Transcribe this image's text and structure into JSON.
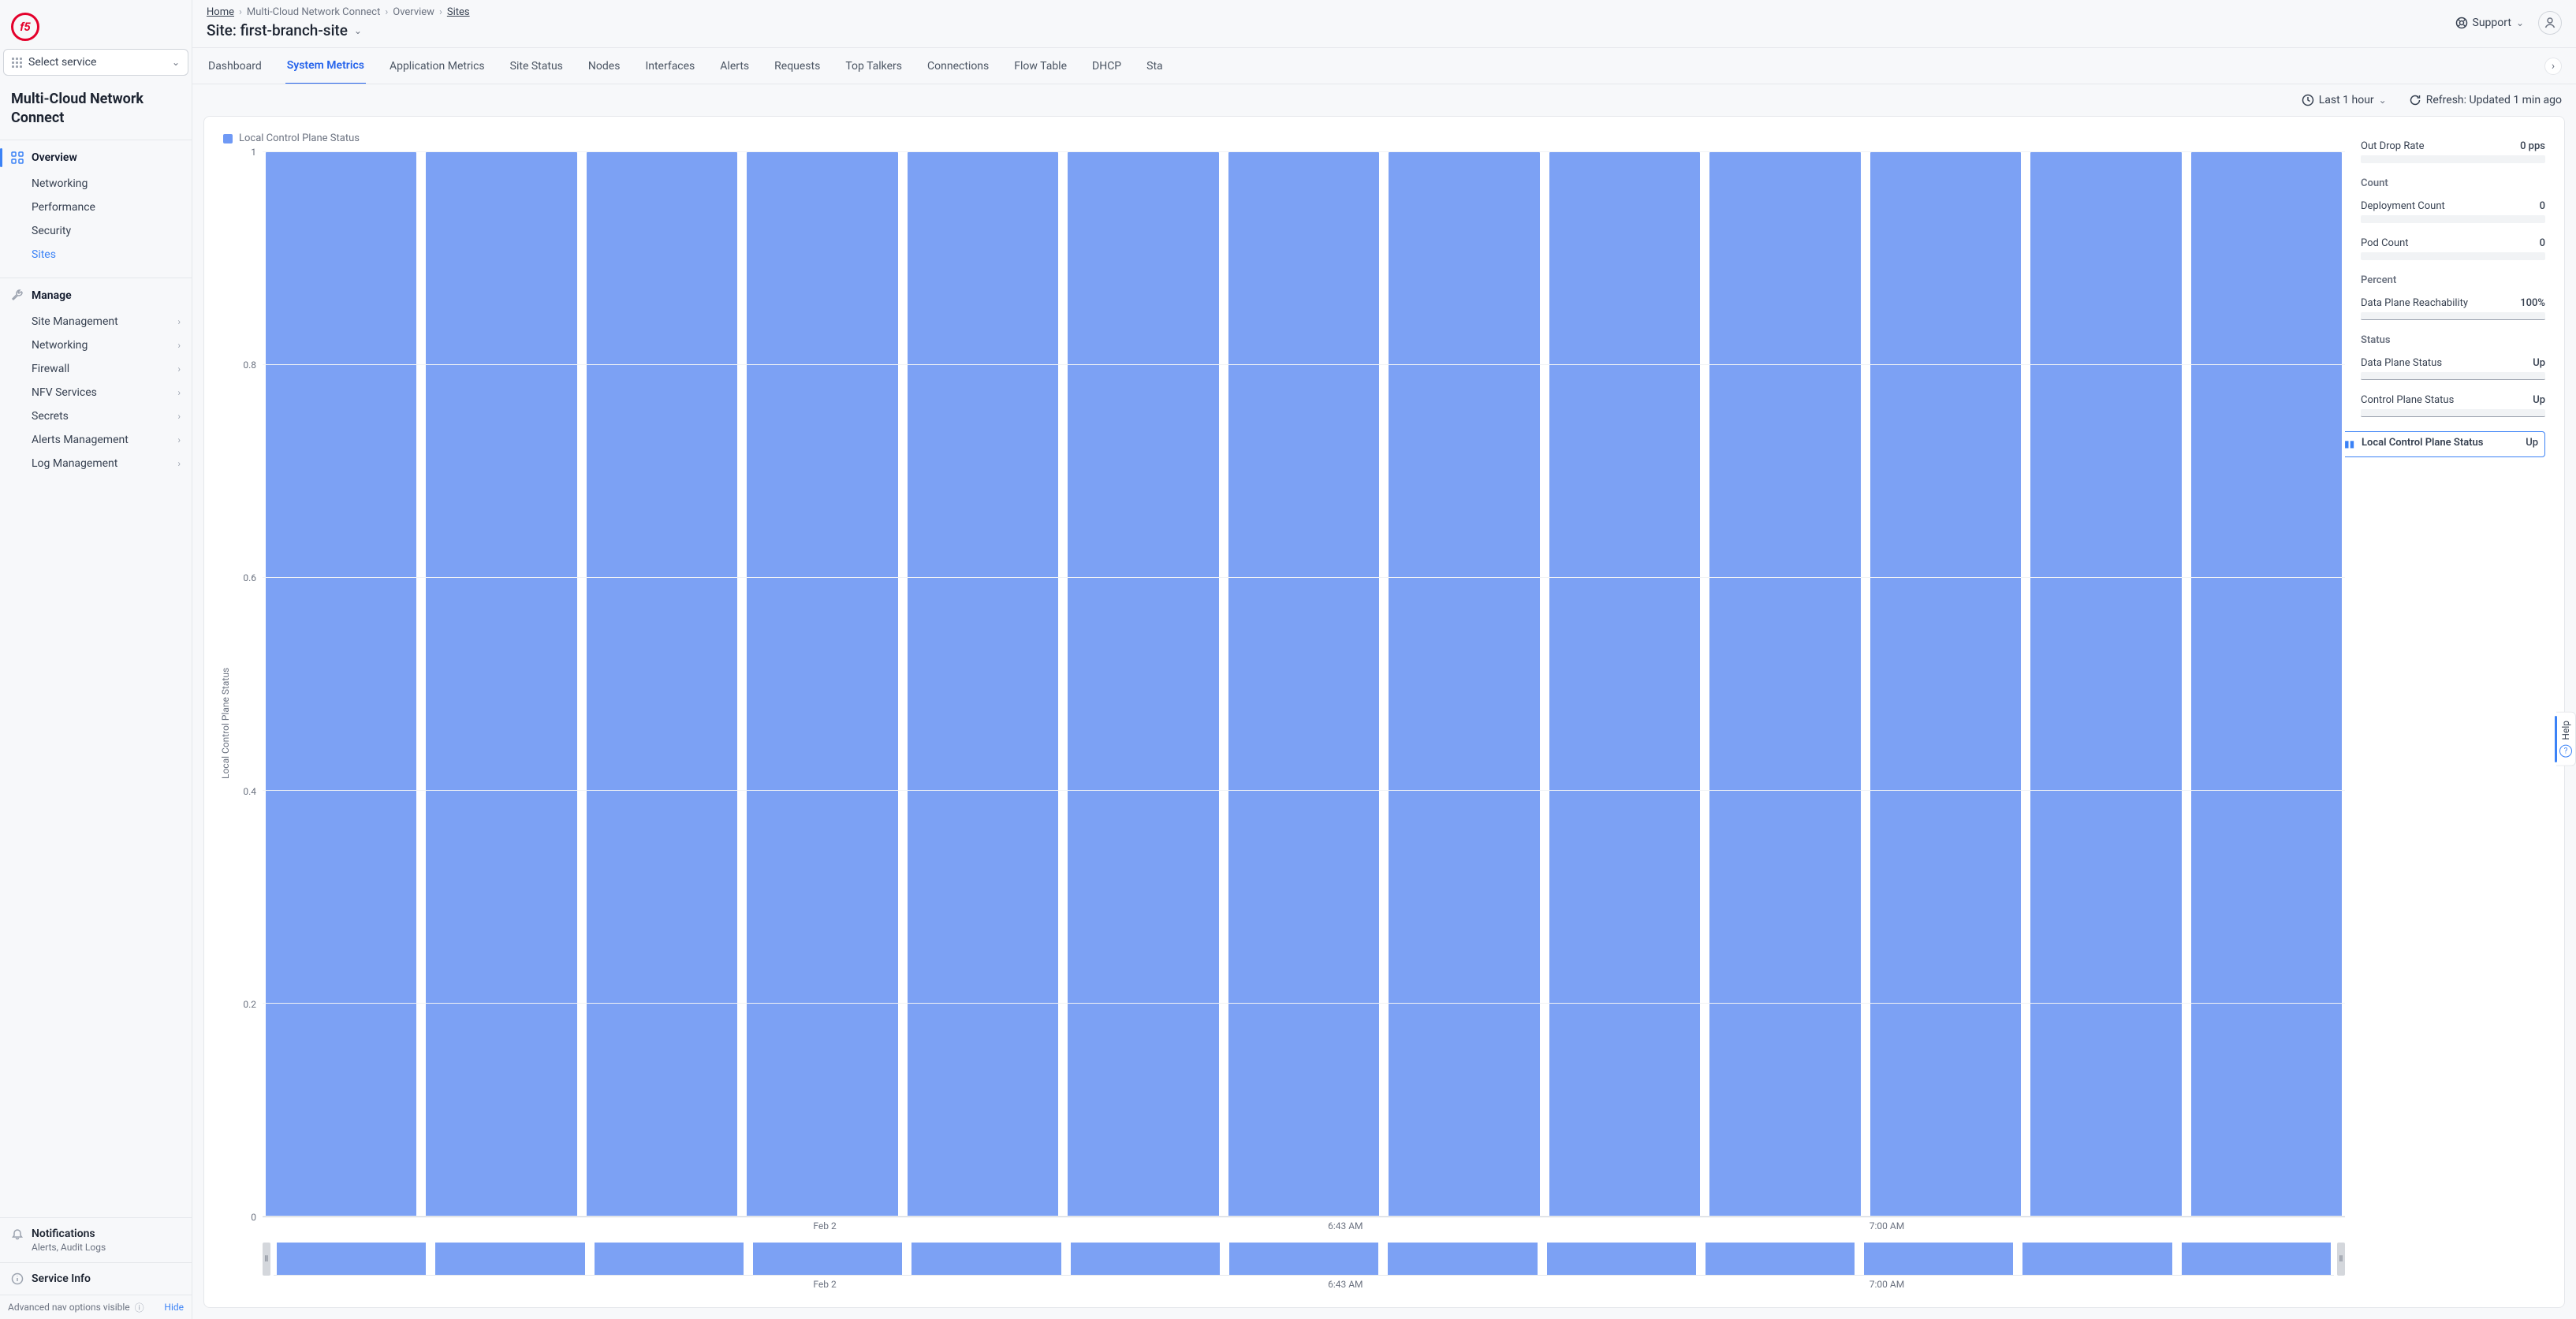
{
  "brand": "f5",
  "select_service_label": "Select service",
  "product_title": "Multi-Cloud Network Connect",
  "nav": {
    "overview": {
      "label": "Overview",
      "items": [
        "Networking",
        "Performance",
        "Security",
        "Sites"
      ],
      "selected": 3
    },
    "manage": {
      "label": "Manage",
      "items": [
        "Site Management",
        "Networking",
        "Firewall",
        "NFV Services",
        "Secrets",
        "Alerts Management",
        "Log Management"
      ]
    },
    "notifications": {
      "label": "Notifications",
      "sub": "Alerts, Audit Logs"
    },
    "service_info": {
      "label": "Service Info"
    },
    "adv": {
      "text": "Advanced nav options visible",
      "action": "Hide"
    }
  },
  "breadcrumb": [
    "Home",
    "Multi-Cloud Network Connect",
    "Overview",
    "Sites"
  ],
  "page_title_prefix": "Site: ",
  "page_title_name": "first-branch-site",
  "support_label": "Support",
  "tabs": [
    "Dashboard",
    "System Metrics",
    "Application Metrics",
    "Site Status",
    "Nodes",
    "Interfaces",
    "Alerts",
    "Requests",
    "Top Talkers",
    "Connections",
    "Flow Table",
    "DHCP",
    "Sta"
  ],
  "tabs_active": 1,
  "time_range": "Last 1 hour",
  "refresh": "Refresh: Updated 1 min ago",
  "chart_data": {
    "type": "bar",
    "title": "Local Control Plane Status",
    "ylabel": "Local Control Plane Status",
    "ylim": [
      0,
      1
    ],
    "yticks": [
      0,
      0.2,
      0.4,
      0.6,
      0.8,
      1
    ],
    "categories": [
      "",
      "",
      "",
      "Feb 2",
      "",
      "",
      "",
      "6:43 AM",
      "",
      "",
      "",
      "7:00 AM",
      ""
    ],
    "xticks": [
      {
        "pos": 27,
        "label": "Feb 2"
      },
      {
        "pos": 52,
        "label": "6:43 AM"
      },
      {
        "pos": 78,
        "label": "7:00 AM"
      }
    ],
    "values": [
      1,
      1,
      1,
      1,
      1,
      1,
      1,
      1,
      1,
      1,
      1,
      1,
      1
    ],
    "brush_values": [
      1,
      1,
      1,
      1,
      1,
      1,
      1,
      1,
      1,
      1,
      1,
      1,
      1
    ]
  },
  "metrics": {
    "top": [
      {
        "label": "Out Drop Rate",
        "value": "0 pps"
      }
    ],
    "groups": [
      {
        "label": "Count",
        "items": [
          {
            "label": "Deployment Count",
            "value": "0"
          },
          {
            "label": "Pod Count",
            "value": "0"
          }
        ]
      },
      {
        "label": "Percent",
        "items": [
          {
            "label": "Data Plane Reachability",
            "value": "100%",
            "spark": "line"
          }
        ]
      },
      {
        "label": "Status",
        "items": [
          {
            "label": "Data Plane Status",
            "value": "Up",
            "spark": "line"
          },
          {
            "label": "Control Plane Status",
            "value": "Up",
            "spark": "line"
          },
          {
            "label": "Local Control Plane Status",
            "value": "Up",
            "selected": true
          }
        ]
      }
    ]
  },
  "help_label": "Help"
}
